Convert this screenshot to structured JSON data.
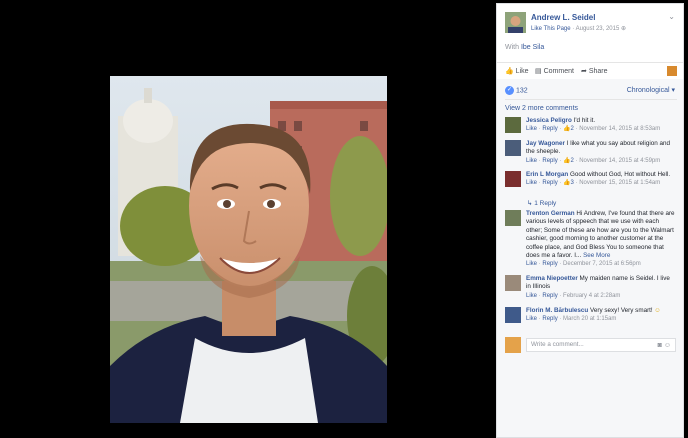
{
  "post": {
    "author": "Andrew L. Seidel",
    "like_page": "Like This Page",
    "date": "August 23, 2015",
    "with_prefix": "With ",
    "with_name": "Ibe Sila"
  },
  "actions": {
    "like": "Like",
    "comment": "Comment",
    "share": "Share"
  },
  "likes_count": "132",
  "sort_label": "Chronological",
  "view_more": "View 2 more comments",
  "comments": [
    {
      "author": "Jessica Peligro",
      "text": "I'd hit it.",
      "like": "Like",
      "reply": "Reply",
      "likes": "2",
      "time": "November 14, 2015 at 8:53am"
    },
    {
      "author": "Jay Wagoner",
      "text": "I like what you say about religion and the sheeple.",
      "like": "Like",
      "reply": "Reply",
      "likes": "2",
      "time": "November 14, 2015 at 4:59pm"
    },
    {
      "author": "Erin L Morgan",
      "text": "Good without God, Hot without Hell.",
      "like": "Like",
      "reply": "Reply",
      "likes": "3",
      "time": "November 15, 2015 at 1:54am"
    },
    {
      "author": "Trenton German",
      "text": "Hi Andrew, I've found that there are various levels of sppeech that we use with each other; Some of these are how are you to the Walmart cashier, good morning to another customer at the coffee place, and God Bless You to someone that does me a favor. I...",
      "see_more": "See More",
      "like": "Like",
      "reply": "Reply",
      "time": "December 7, 2015 at 6:56pm"
    },
    {
      "author": "Emma Niepoetter",
      "text": "My maiden name is Seidel. I live in Illinois",
      "like": "Like",
      "reply": "Reply",
      "time": "February 4 at 2:28am"
    },
    {
      "author": "Florin M. Bărbulescu",
      "text": "Very sexy! Very smart!",
      "like": "Like",
      "reply": "Reply",
      "time": "March 20 at 1:15am"
    }
  ],
  "reply_link": "1 Reply",
  "write_placeholder": "Write a comment..."
}
